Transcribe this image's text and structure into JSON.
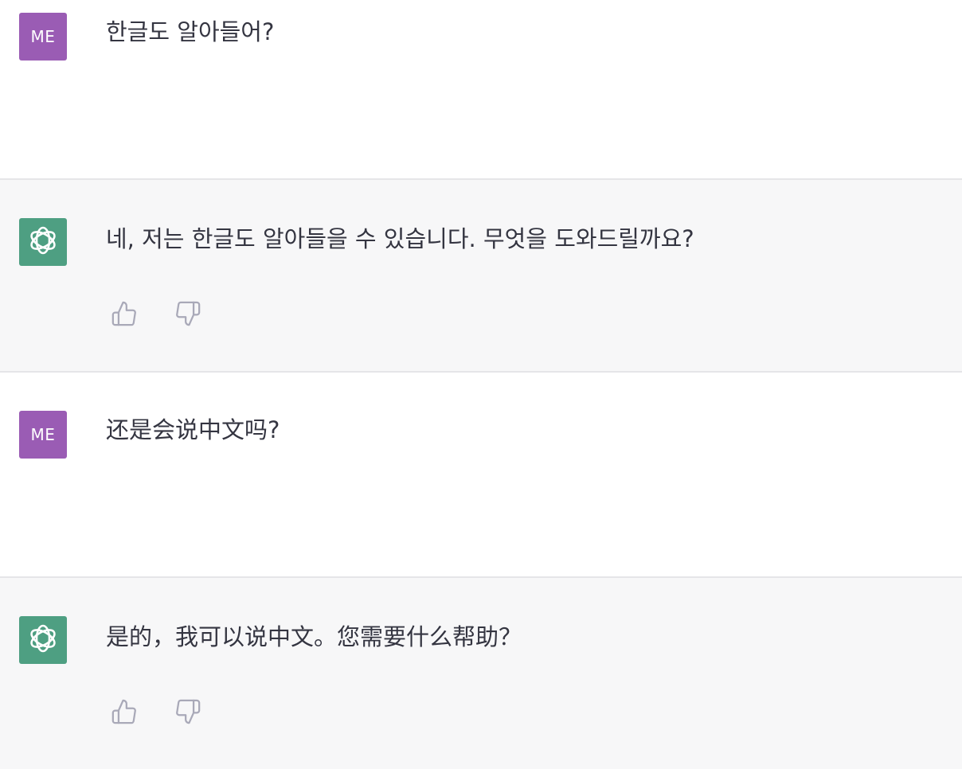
{
  "conversation": [
    {
      "role": "user",
      "avatar_label": "ME",
      "text": "한글도 알아들어?"
    },
    {
      "role": "assistant",
      "avatar_icon": "openai-logo-icon",
      "text": "네, 저는 한글도 알아들을 수 있습니다. 무엇을 도와드릴까요?"
    },
    {
      "role": "user",
      "avatar_label": "ME",
      "text": "还是会说中文吗?"
    },
    {
      "role": "assistant",
      "avatar_icon": "openai-logo-icon",
      "text": "是的，我可以说中文。您需要什么帮助？"
    }
  ],
  "colors": {
    "user_avatar": "#9a5cb4",
    "assistant_avatar": "#4e9f82",
    "assistant_row_bg": "#f7f7f8",
    "icon_color": "#a9a9b8"
  },
  "icons": {
    "like": "thumbs-up-icon",
    "dislike": "thumbs-down-icon"
  }
}
